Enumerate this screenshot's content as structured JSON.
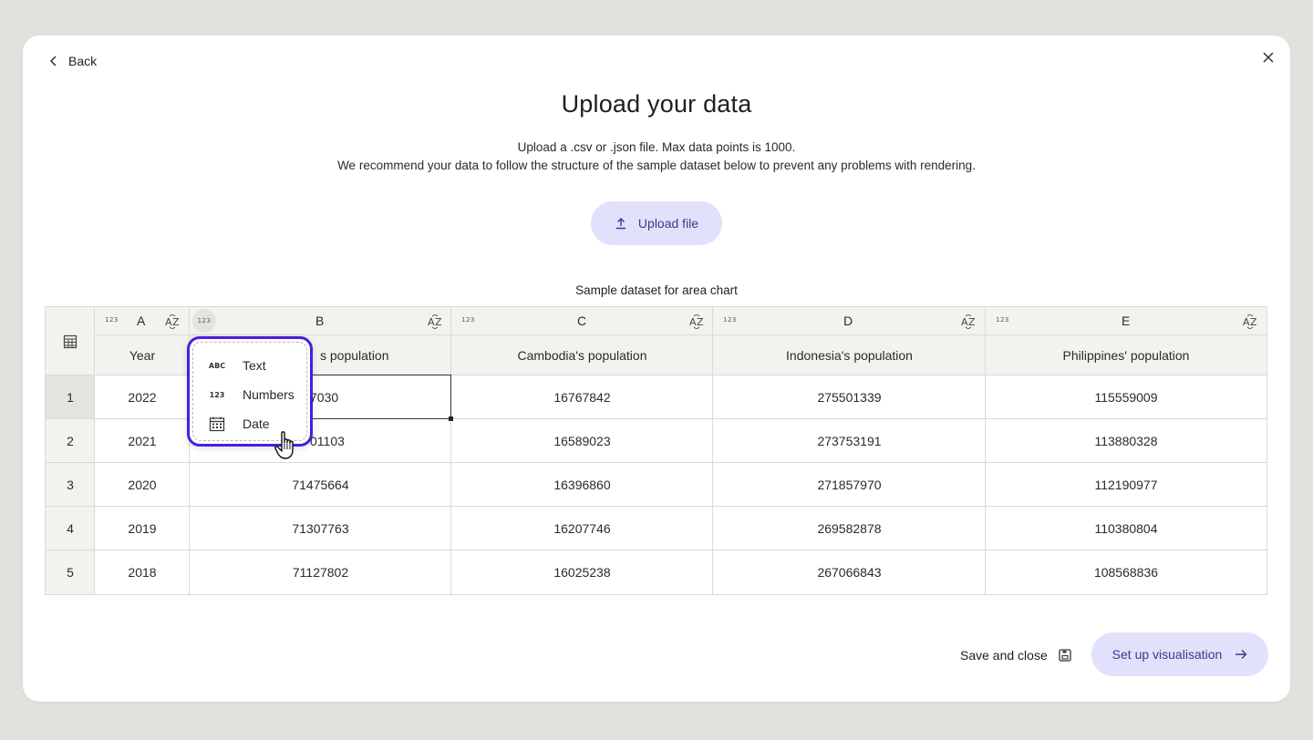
{
  "nav": {
    "back_label": "Back"
  },
  "header": {
    "title": "Upload your data",
    "subtitle_line1": "Upload a .csv or .json file. Max data points is 1000.",
    "subtitle_line2": "We recommend your data to follow the structure of the sample dataset below to prevent any problems with rendering."
  },
  "upload": {
    "label": "Upload file"
  },
  "dataset": {
    "caption": "Sample dataset for area chart",
    "type_icon_text": "123",
    "sort_icon_text": "AZ",
    "columns": [
      {
        "letter": "A",
        "name": "Year"
      },
      {
        "letter": "B",
        "name": "Thailand's population",
        "visible_name": "s population"
      },
      {
        "letter": "C",
        "name": "Cambodia's population"
      },
      {
        "letter": "D",
        "name": "Indonesia's population"
      },
      {
        "letter": "E",
        "name": "Philippines' population"
      }
    ],
    "rows": [
      {
        "index": "1",
        "cells": [
          "2022",
          "7030",
          "16767842",
          "275501339",
          "115559009"
        ]
      },
      {
        "index": "2",
        "cells": [
          "2021",
          "01103",
          "16589023",
          "273753191",
          "113880328"
        ]
      },
      {
        "index": "3",
        "cells": [
          "2020",
          "71475664",
          "16396860",
          "271857970",
          "112190977"
        ]
      },
      {
        "index": "4",
        "cells": [
          "2019",
          "71307763",
          "16207746",
          "269582878",
          "110380804"
        ]
      },
      {
        "index": "5",
        "cells": [
          "2018",
          "71127802",
          "16025238",
          "267066843",
          "108568836"
        ]
      }
    ]
  },
  "type_menu": {
    "items": [
      {
        "label": "Text",
        "icon": "abc-icon",
        "icon_text": "ABC"
      },
      {
        "label": "Numbers",
        "icon": "numbers-icon",
        "icon_text": "123"
      },
      {
        "label": "Date",
        "icon": "calendar-icon"
      }
    ]
  },
  "footer": {
    "save_close_label": "Save and close",
    "setup_label": "Set up visualisation"
  },
  "colors": {
    "accent": "#4a1de0",
    "button_bg": "#e2e1fb",
    "button_text": "#3b3a8c",
    "header_bg": "#f2f2ef"
  }
}
